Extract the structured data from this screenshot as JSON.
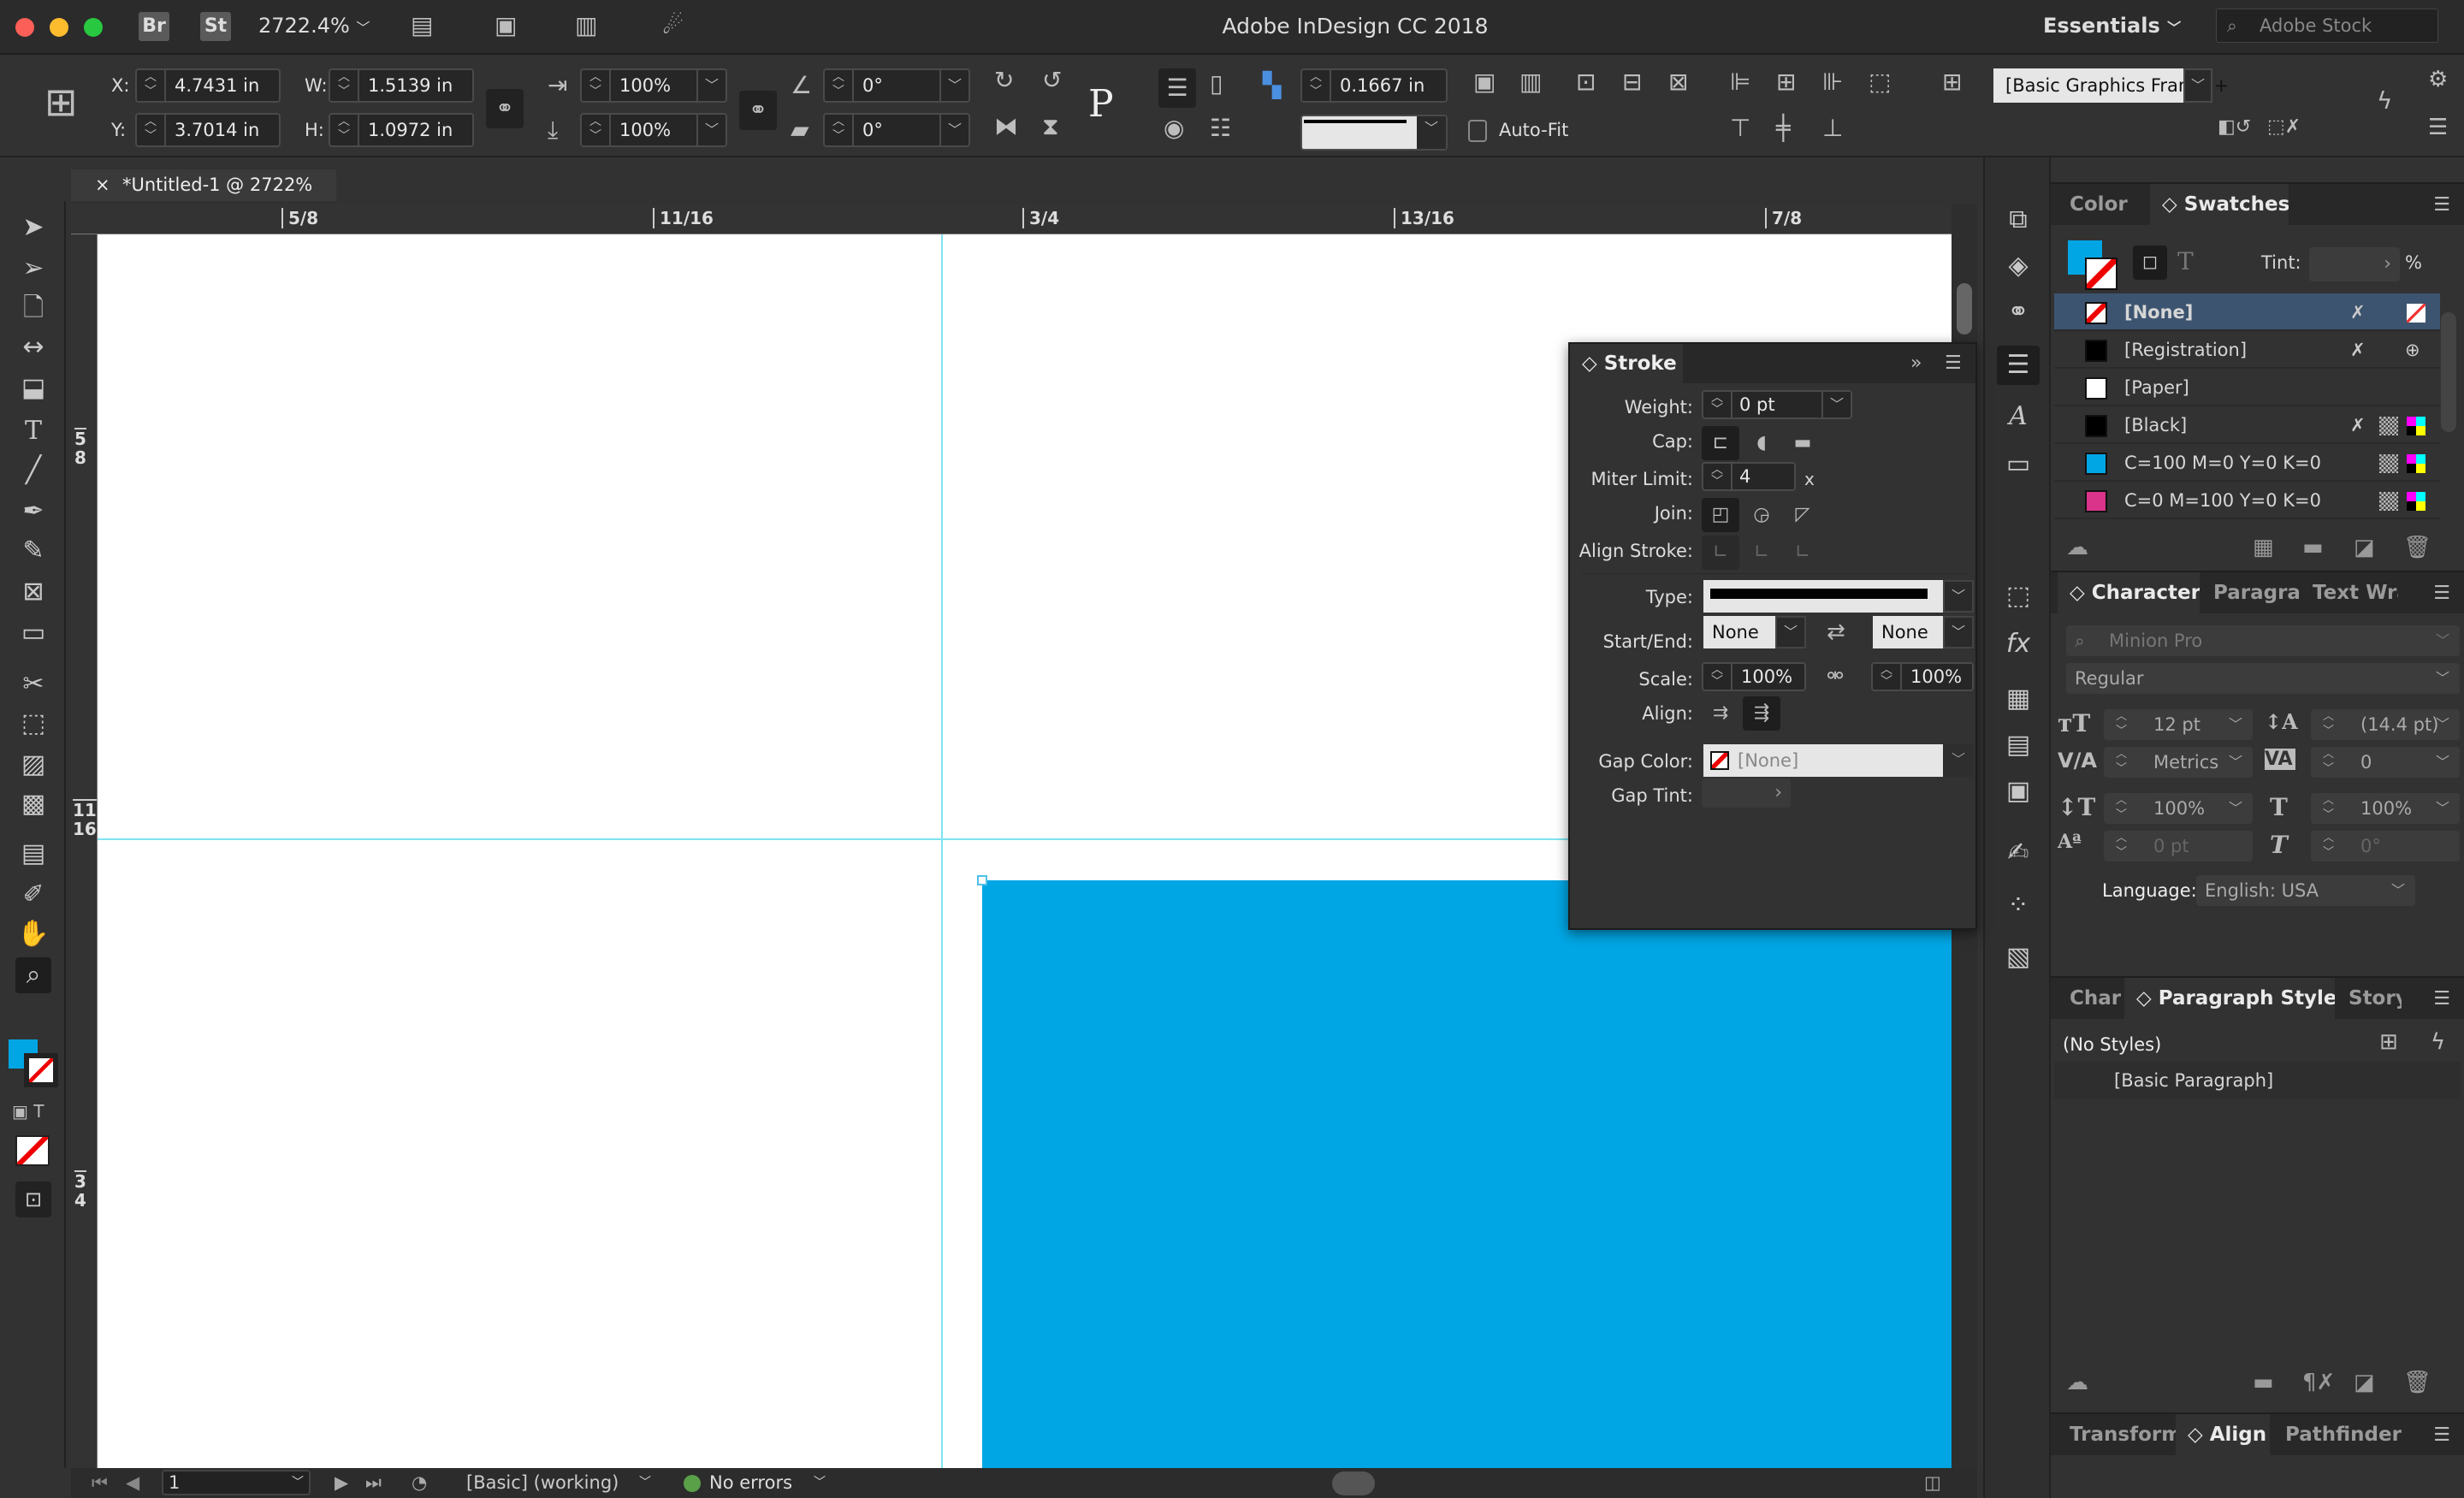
{
  "app": {
    "title": "Adobe InDesign CC 2018",
    "zoom": "2722.4%",
    "workspace": "Essentials",
    "stock_search_placeholder": "Adobe Stock",
    "bridge": "Br",
    "stock": "St"
  },
  "control": {
    "x_label": "X:",
    "x": "4.7431 in",
    "y_label": "Y:",
    "y": "3.7014 in",
    "w_label": "W:",
    "w": "1.5139 in",
    "h_label": "H:",
    "h": "1.0972 in",
    "scale_x": "100%",
    "scale_y": "100%",
    "rotate": "0°",
    "shear": "0°",
    "stroke_weight": "0.1667 in",
    "autofit": "Auto-Fit",
    "object_style": "[Basic Graphics Frame]+"
  },
  "document": {
    "tab_title": "*Untitled-1 @ 2722%",
    "close": "×",
    "hruler": [
      "5/8",
      "11/16",
      "3/4",
      "13/16",
      "7/8"
    ],
    "vruler": [
      [
        "5",
        "8"
      ],
      [
        "11",
        "16"
      ],
      [
        "3",
        "4"
      ]
    ],
    "fill_color": "#00a6e4"
  },
  "status": {
    "page": "1",
    "preflight_profile": "[Basic] (working)",
    "errors": "No errors",
    "error_color": "#5aa049"
  },
  "swatches": {
    "tabs": [
      "Color",
      "Swatches"
    ],
    "tint_label": "Tint:",
    "tint_unit": "%",
    "items": [
      {
        "name": "[None]",
        "color": "none",
        "selected": true
      },
      {
        "name": "[Registration]",
        "color": "#000000"
      },
      {
        "name": "[Paper]",
        "color": "#ffffff"
      },
      {
        "name": "[Black]",
        "color": "#000000"
      },
      {
        "name": "C=100 M=0 Y=0 K=0",
        "color": "#00a6e4"
      },
      {
        "name": "C=0 M=100 Y=0 K=0",
        "color": "#d9338a"
      }
    ]
  },
  "character": {
    "tabs": [
      "Character",
      "Paragraph",
      "Text Wrap"
    ],
    "font": "Minion Pro",
    "style": "Regular",
    "size": "12 pt",
    "leading": "(14.4 pt)",
    "kerning": "Metrics",
    "tracking": "0",
    "vscale": "100%",
    "hscale": "100%",
    "baseline": "0 pt",
    "skew": "0°",
    "language_label": "Language:",
    "language": "English: USA"
  },
  "paragraph_styles": {
    "tabs": [
      "Char",
      "Paragraph Styles",
      "Story"
    ],
    "no_styles": "(No Styles)",
    "items": [
      "[Basic Paragraph]"
    ]
  },
  "bottom_panel": {
    "tabs": [
      "Transform",
      "Align",
      "Pathfinder"
    ]
  },
  "stroke": {
    "title": "Stroke",
    "weight_label": "Weight:",
    "weight": "0 pt",
    "cap_label": "Cap:",
    "miter_label": "Miter Limit:",
    "miter": "4",
    "miter_unit": "x",
    "join_label": "Join:",
    "align_stroke_label": "Align Stroke:",
    "type_label": "Type:",
    "startend_label": "Start/End:",
    "start": "None",
    "end": "None",
    "scale_label": "Scale:",
    "scale_start": "100%",
    "scale_end": "100%",
    "align_label": "Align:",
    "gap_color_label": "Gap Color:",
    "gap_color": "[None]",
    "gap_tint_label": "Gap Tint:"
  }
}
